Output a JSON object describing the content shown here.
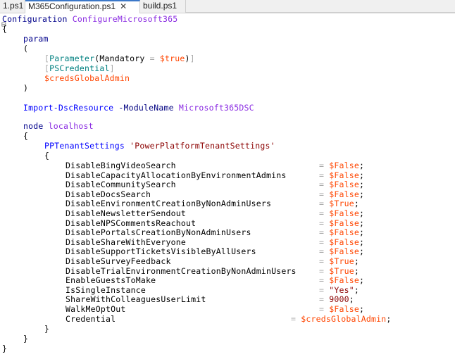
{
  "tabs": [
    {
      "label": "1.ps1",
      "active": false
    },
    {
      "label": "M365Configuration.ps1",
      "active": true
    },
    {
      "label": "build.ps1",
      "active": false
    }
  ],
  "code": {
    "configuration_kw": "Configuration",
    "configuration_name": "ConfigureMicrosoft365",
    "open_brace": "{",
    "close_brace": "}",
    "param_kw": "param",
    "open_paren": "(",
    "close_paren": ")",
    "parameter_attr_open": "[",
    "parameter_attr_name": "Parameter",
    "parameter_attr_args_open": "(",
    "parameter_mandatory": "Mandatory",
    "parameter_eq": " = ",
    "parameter_true": "$true",
    "parameter_attr_args_close": ")",
    "parameter_attr_close": "]",
    "pscred_open": "[",
    "pscred_type": "PSCredential",
    "pscred_close": "]",
    "creds_var": "$credsGlobalAdmin",
    "import_cmd": "Import-DscResource",
    "import_param": " -ModuleName ",
    "import_module": "Microsoft365DSC",
    "node_kw": "node",
    "node_name": "localhost",
    "resource_type": "PPTenantSettings",
    "resource_name": "'PowerPlatformTenantSettings'",
    "settings": [
      {
        "key": "DisableBingVideoSearch",
        "value": "$False",
        "kind": "var"
      },
      {
        "key": "DisableCapacityAllocationByEnvironmentAdmins",
        "value": "$False",
        "kind": "var"
      },
      {
        "key": "DisableCommunitySearch",
        "value": "$False",
        "kind": "var"
      },
      {
        "key": "DisableDocsSearch",
        "value": "$False",
        "kind": "var"
      },
      {
        "key": "DisableEnvironmentCreationByNonAdminUsers",
        "value": "$True",
        "kind": "var"
      },
      {
        "key": "DisableNewsletterSendout",
        "value": "$False",
        "kind": "var"
      },
      {
        "key": "DisableNPSCommentsReachout",
        "value": "$False",
        "kind": "var"
      },
      {
        "key": "DisablePortalsCreationByNonAdminUsers",
        "value": "$False",
        "kind": "var"
      },
      {
        "key": "DisableShareWithEveryone",
        "value": "$False",
        "kind": "var"
      },
      {
        "key": "DisableSupportTicketsVisibleByAllUsers",
        "value": "$False",
        "kind": "var"
      },
      {
        "key": "DisableSurveyFeedback",
        "value": "$True",
        "kind": "var"
      },
      {
        "key": "DisableTrialEnvironmentCreationByNonAdminUsers",
        "value": "$True",
        "kind": "var"
      },
      {
        "key": "EnableGuestsToMake",
        "value": "$False",
        "kind": "var"
      },
      {
        "key": "IsSingleInstance",
        "value": "\"Yes\"",
        "kind": "str"
      },
      {
        "key": "ShareWithColleaguesUserLimit",
        "value": "9000",
        "kind": "num"
      },
      {
        "key": "WalkMeOptOut",
        "value": "$False",
        "kind": "var"
      }
    ],
    "credential_key": "Credential",
    "credential_eq": "= ",
    "credential_value": "$credsGlobalAdmin",
    "assign_eq": "= ",
    "semicolon": ";"
  },
  "colors": {
    "keyword": "#00008b",
    "function_name": "#8a2be2",
    "command": "#0000ff",
    "type": "#008080",
    "variable": "#ff4500",
    "string": "#8b0000",
    "active_tab_accent": "#3c78c8"
  }
}
